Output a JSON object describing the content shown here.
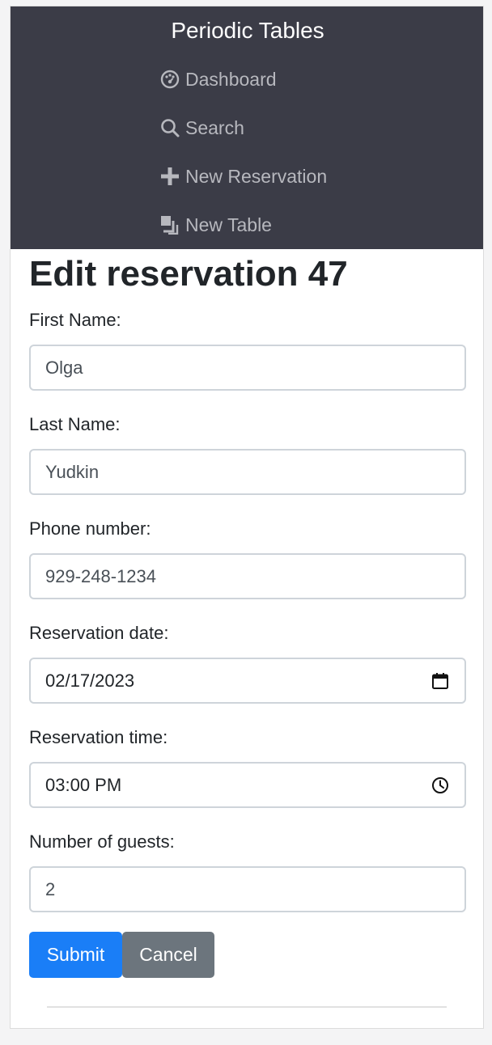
{
  "app": {
    "brand": "Periodic Tables"
  },
  "nav": {
    "items": [
      {
        "label": "Dashboard",
        "icon": "dashboard-icon"
      },
      {
        "label": "Search",
        "icon": "search-icon"
      },
      {
        "label": "New Reservation",
        "icon": "plus-icon"
      },
      {
        "label": "New Table",
        "icon": "new-table-icon"
      }
    ]
  },
  "page": {
    "title": "Edit reservation 47"
  },
  "form": {
    "first_name": {
      "label": "First Name:",
      "value": "Olga"
    },
    "last_name": {
      "label": "Last Name:",
      "value": "Yudkin"
    },
    "phone": {
      "label": "Phone number:",
      "value": "929-248-1234"
    },
    "date": {
      "label": "Reservation date:",
      "value": "02/17/2023",
      "icon": "calendar-icon"
    },
    "time": {
      "label": "Reservation time:",
      "value": "03:00 PM",
      "icon": "clock-icon"
    },
    "guests": {
      "label": "Number of guests:",
      "value": "2"
    }
  },
  "buttons": {
    "submit": "Submit",
    "cancel": "Cancel"
  },
  "colors": {
    "sidebar_bg": "#3b3c47",
    "primary": "#1a7ef7",
    "secondary": "#6c757d"
  }
}
